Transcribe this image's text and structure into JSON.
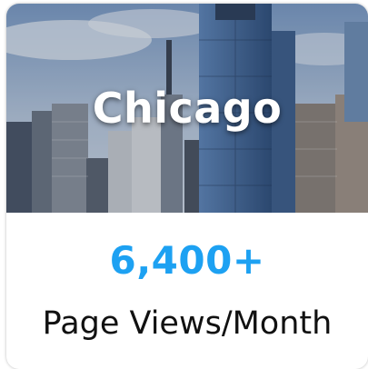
{
  "card": {
    "city": "Chicago",
    "stat_value": "6,400+",
    "stat_label": "Page Views/Month",
    "stat_color": "#1da1f2",
    "image_icon": "chicago-skyline-photo"
  }
}
